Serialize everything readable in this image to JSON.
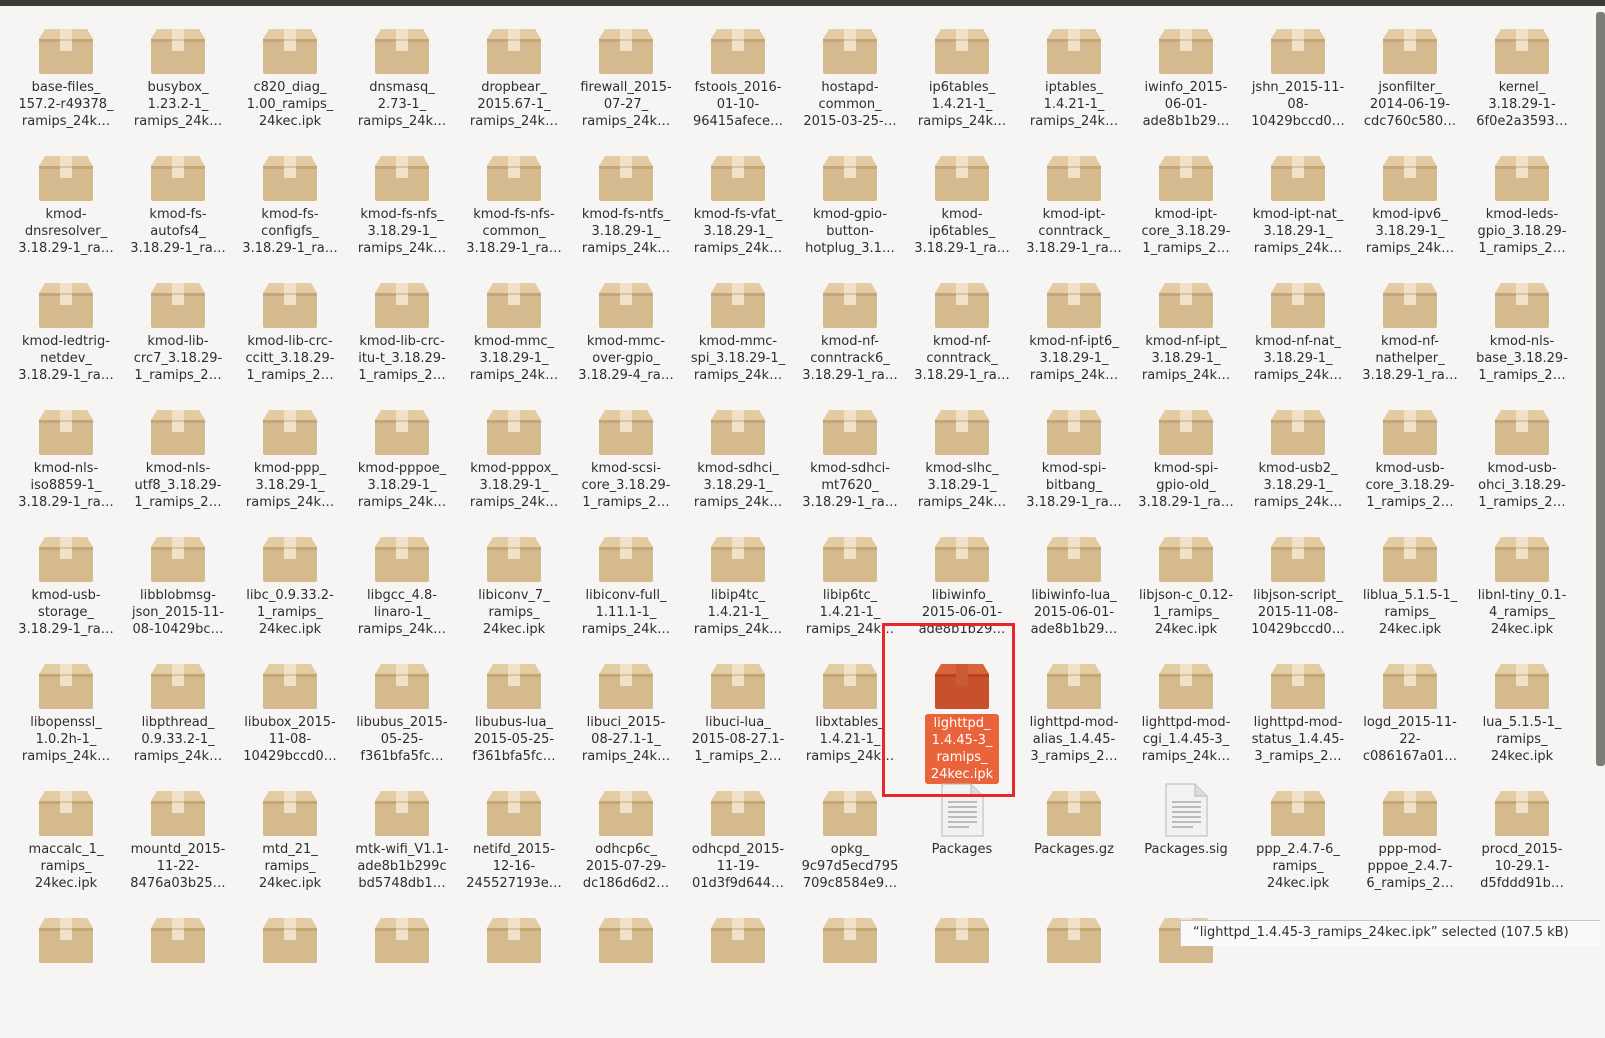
{
  "status_text": "“lighttpd_1.4.45-3_ramips_24kec.ipk” selected (107.5 kB)",
  "colors": {
    "selection": "#e9643a",
    "highlight_box": "#e8262c",
    "package_icon": "#d5b98f"
  },
  "files": [
    {
      "label": "base-files_\n157.2-r49378_\nramips_24k…",
      "icon": "package-icon"
    },
    {
      "label": "busybox_\n1.23.2-1_\nramips_24k…",
      "icon": "package-icon"
    },
    {
      "label": "c820_diag_\n1.00_ramips_\n24kec.ipk",
      "icon": "package-icon"
    },
    {
      "label": "dnsmasq_\n2.73-1_\nramips_24k…",
      "icon": "package-icon"
    },
    {
      "label": "dropbear_\n2015.67-1_\nramips_24k…",
      "icon": "package-icon"
    },
    {
      "label": "firewall_2015-\n07-27_\nramips_24k…",
      "icon": "package-icon"
    },
    {
      "label": "fstools_2016-\n01-10-\n96415afece…",
      "icon": "package-icon"
    },
    {
      "label": "hostapd-\ncommon_\n2015-03-25-…",
      "icon": "package-icon"
    },
    {
      "label": "ip6tables_\n1.4.21-1_\nramips_24k…",
      "icon": "package-icon"
    },
    {
      "label": "iptables_\n1.4.21-1_\nramips_24k…",
      "icon": "package-icon"
    },
    {
      "label": "iwinfo_2015-\n06-01-\nade8b1b29…",
      "icon": "package-icon"
    },
    {
      "label": "jshn_2015-11-\n08-\n10429bccd0…",
      "icon": "package-icon"
    },
    {
      "label": "jsonfilter_\n2014-06-19-\ncdc760c580…",
      "icon": "package-icon"
    },
    {
      "label": "kernel_\n3.18.29-1-\n6f0e2a3593…",
      "icon": "package-icon"
    },
    {
      "label": "kmod-\ndnsresolver_\n3.18.29-1_ra…",
      "icon": "package-icon"
    },
    {
      "label": "kmod-fs-\nautofs4_\n3.18.29-1_ra…",
      "icon": "package-icon"
    },
    {
      "label": "kmod-fs-\nconfigfs_\n3.18.29-1_ra…",
      "icon": "package-icon"
    },
    {
      "label": "kmod-fs-nfs_\n3.18.29-1_\nramips_24k…",
      "icon": "package-icon"
    },
    {
      "label": "kmod-fs-nfs-\ncommon_\n3.18.29-1_ra…",
      "icon": "package-icon"
    },
    {
      "label": "kmod-fs-ntfs_\n3.18.29-1_\nramips_24k…",
      "icon": "package-icon"
    },
    {
      "label": "kmod-fs-vfat_\n3.18.29-1_\nramips_24k…",
      "icon": "package-icon"
    },
    {
      "label": "kmod-gpio-\nbutton-\nhotplug_3.1…",
      "icon": "package-icon"
    },
    {
      "label": "kmod-\nip6tables_\n3.18.29-1_ra…",
      "icon": "package-icon"
    },
    {
      "label": "kmod-ipt-\nconntrack_\n3.18.29-1_ra…",
      "icon": "package-icon"
    },
    {
      "label": "kmod-ipt-\ncore_3.18.29-\n1_ramips_2…",
      "icon": "package-icon"
    },
    {
      "label": "kmod-ipt-nat_\n3.18.29-1_\nramips_24k…",
      "icon": "package-icon"
    },
    {
      "label": "kmod-ipv6_\n3.18.29-1_\nramips_24k…",
      "icon": "package-icon"
    },
    {
      "label": "kmod-leds-\ngpio_3.18.29-\n1_ramips_2…",
      "icon": "package-icon"
    },
    {
      "label": "kmod-ledtrig-\nnetdev_\n3.18.29-1_ra…",
      "icon": "package-icon"
    },
    {
      "label": "kmod-lib-\ncrc7_3.18.29-\n1_ramips_2…",
      "icon": "package-icon"
    },
    {
      "label": "kmod-lib-crc-\nccitt_3.18.29-\n1_ramips_2…",
      "icon": "package-icon"
    },
    {
      "label": "kmod-lib-crc-\nitu-t_3.18.29-\n1_ramips_2…",
      "icon": "package-icon"
    },
    {
      "label": "kmod-mmc_\n3.18.29-1_\nramips_24k…",
      "icon": "package-icon"
    },
    {
      "label": "kmod-mmc-\nover-gpio_\n3.18.29-4_ra…",
      "icon": "package-icon"
    },
    {
      "label": "kmod-mmc-\nspi_3.18.29-1_\nramips_24k…",
      "icon": "package-icon"
    },
    {
      "label": "kmod-nf-\nconntrack6_\n3.18.29-1_ra…",
      "icon": "package-icon"
    },
    {
      "label": "kmod-nf-\nconntrack_\n3.18.29-1_ra…",
      "icon": "package-icon"
    },
    {
      "label": "kmod-nf-ipt6_\n3.18.29-1_\nramips_24k…",
      "icon": "package-icon"
    },
    {
      "label": "kmod-nf-ipt_\n3.18.29-1_\nramips_24k…",
      "icon": "package-icon"
    },
    {
      "label": "kmod-nf-nat_\n3.18.29-1_\nramips_24k…",
      "icon": "package-icon"
    },
    {
      "label": "kmod-nf-\nnathelper_\n3.18.29-1_ra…",
      "icon": "package-icon"
    },
    {
      "label": "kmod-nls-\nbase_3.18.29-\n1_ramips_2…",
      "icon": "package-icon"
    },
    {
      "label": "kmod-nls-\niso8859-1_\n3.18.29-1_ra…",
      "icon": "package-icon"
    },
    {
      "label": "kmod-nls-\nutf8_3.18.29-\n1_ramips_2…",
      "icon": "package-icon"
    },
    {
      "label": "kmod-ppp_\n3.18.29-1_\nramips_24k…",
      "icon": "package-icon"
    },
    {
      "label": "kmod-pppoe_\n3.18.29-1_\nramips_24k…",
      "icon": "package-icon"
    },
    {
      "label": "kmod-pppox_\n3.18.29-1_\nramips_24k…",
      "icon": "package-icon"
    },
    {
      "label": "kmod-scsi-\ncore_3.18.29-\n1_ramips_2…",
      "icon": "package-icon"
    },
    {
      "label": "kmod-sdhci_\n3.18.29-1_\nramips_24k…",
      "icon": "package-icon"
    },
    {
      "label": "kmod-sdhci-\nmt7620_\n3.18.29-1_ra…",
      "icon": "package-icon"
    },
    {
      "label": "kmod-slhc_\n3.18.29-1_\nramips_24k…",
      "icon": "package-icon"
    },
    {
      "label": "kmod-spi-\nbitbang_\n3.18.29-1_ra…",
      "icon": "package-icon"
    },
    {
      "label": "kmod-spi-\ngpio-old_\n3.18.29-1_ra…",
      "icon": "package-icon"
    },
    {
      "label": "kmod-usb2_\n3.18.29-1_\nramips_24k…",
      "icon": "package-icon"
    },
    {
      "label": "kmod-usb-\ncore_3.18.29-\n1_ramips_2…",
      "icon": "package-icon"
    },
    {
      "label": "kmod-usb-\nohci_3.18.29-\n1_ramips_2…",
      "icon": "package-icon"
    },
    {
      "label": "kmod-usb-\nstorage_\n3.18.29-1_ra…",
      "icon": "package-icon"
    },
    {
      "label": "libblobmsg-\njson_2015-11-\n08-10429bc…",
      "icon": "package-icon"
    },
    {
      "label": "libc_0.9.33.2-\n1_ramips_\n24kec.ipk",
      "icon": "package-icon"
    },
    {
      "label": "libgcc_4.8-\nlinaro-1_\nramips_24k…",
      "icon": "package-icon"
    },
    {
      "label": "libiconv_7_\nramips_\n24kec.ipk",
      "icon": "package-icon"
    },
    {
      "label": "libiconv-full_\n1.11.1-1_\nramips_24k…",
      "icon": "package-icon"
    },
    {
      "label": "libip4tc_\n1.4.21-1_\nramips_24k…",
      "icon": "package-icon"
    },
    {
      "label": "libip6tc_\n1.4.21-1_\nramips_24k…",
      "icon": "package-icon"
    },
    {
      "label": "libiwinfo_\n2015-06-01-\nade8b1b29…",
      "icon": "package-icon"
    },
    {
      "label": "libiwinfo-lua_\n2015-06-01-\nade8b1b29…",
      "icon": "package-icon"
    },
    {
      "label": "libjson-c_0.12-\n1_ramips_\n24kec.ipk",
      "icon": "package-icon"
    },
    {
      "label": "libjson-script_\n2015-11-08-\n10429bccd0…",
      "icon": "package-icon"
    },
    {
      "label": "liblua_5.1.5-1_\nramips_\n24kec.ipk",
      "icon": "package-icon"
    },
    {
      "label": "libnl-tiny_0.1-\n4_ramips_\n24kec.ipk",
      "icon": "package-icon"
    },
    {
      "label": "libopenssl_\n1.0.2h-1_\nramips_24k…",
      "icon": "package-icon"
    },
    {
      "label": "libpthread_\n0.9.33.2-1_\nramips_24k…",
      "icon": "package-icon"
    },
    {
      "label": "libubox_2015-\n11-08-\n10429bccd0…",
      "icon": "package-icon"
    },
    {
      "label": "libubus_2015-\n05-25-\nf361bfa5fc…",
      "icon": "package-icon"
    },
    {
      "label": "libubus-lua_\n2015-05-25-\nf361bfa5fc…",
      "icon": "package-icon"
    },
    {
      "label": "libuci_2015-\n08-27.1-1_\nramips_24k…",
      "icon": "package-icon"
    },
    {
      "label": "libuci-lua_\n2015-08-27.1-\n1_ramips_2…",
      "icon": "package-icon"
    },
    {
      "label": "libxtables_\n1.4.21-1_\nramips_24k…",
      "icon": "package-icon"
    },
    {
      "label": "lighttpd_\n1.4.45-3_\nramips_\n24kec.ipk",
      "icon": "package-icon",
      "selected": true
    },
    {
      "label": "lighttpd-mod-\nalias_1.4.45-\n3_ramips_2…",
      "icon": "package-icon"
    },
    {
      "label": "lighttpd-mod-\ncgi_1.4.45-3_\nramips_24k…",
      "icon": "package-icon"
    },
    {
      "label": "lighttpd-mod-\nstatus_1.4.45-\n3_ramips_2…",
      "icon": "package-icon"
    },
    {
      "label": "logd_2015-11-\n22-\nc086167a01…",
      "icon": "package-icon"
    },
    {
      "label": "lua_5.1.5-1_\nramips_\n24kec.ipk",
      "icon": "package-icon"
    },
    {
      "label": "maccalc_1_\nramips_\n24kec.ipk",
      "icon": "package-icon"
    },
    {
      "label": "mountd_2015-\n11-22-\n8476a03b25…",
      "icon": "package-icon"
    },
    {
      "label": "mtd_21_\nramips_\n24kec.ipk",
      "icon": "package-icon"
    },
    {
      "label": "mtk-wifi_V1.1-\nade8b1b299c\nbd5748db1…",
      "icon": "package-icon"
    },
    {
      "label": "netifd_2015-\n12-16-\n245527193e…",
      "icon": "package-icon"
    },
    {
      "label": "odhcp6c_\n2015-07-29-\ndc186d6d2…",
      "icon": "package-icon"
    },
    {
      "label": "odhcpd_2015-\n11-19-\n01d3f9d644…",
      "icon": "package-icon"
    },
    {
      "label": "opkg_\n9c97d5ecd795\n709c8584e9…",
      "icon": "package-icon"
    },
    {
      "label": "Packages",
      "icon": "text-file-icon"
    },
    {
      "label": "Packages.gz",
      "icon": "package-icon"
    },
    {
      "label": "Packages.sig",
      "icon": "text-file-icon"
    },
    {
      "label": "ppp_2.4.7-6_\nramips_\n24kec.ipk",
      "icon": "package-icon"
    },
    {
      "label": "ppp-mod-\npppoe_2.4.7-\n6_ramips_2…",
      "icon": "package-icon"
    },
    {
      "label": "procd_2015-\n10-29.1-\nd5fddd91b…",
      "icon": "package-icon"
    },
    {
      "label": "",
      "icon": "package-icon"
    },
    {
      "label": "",
      "icon": "package-icon"
    },
    {
      "label": "",
      "icon": "package-icon"
    },
    {
      "label": "",
      "icon": "package-icon"
    },
    {
      "label": "",
      "icon": "package-icon"
    },
    {
      "label": "",
      "icon": "package-icon"
    },
    {
      "label": "",
      "icon": "package-icon"
    },
    {
      "label": "",
      "icon": "package-icon"
    },
    {
      "label": "",
      "icon": "package-icon"
    },
    {
      "label": "",
      "icon": "package-icon"
    },
    {
      "label": "",
      "icon": "package-icon"
    }
  ]
}
